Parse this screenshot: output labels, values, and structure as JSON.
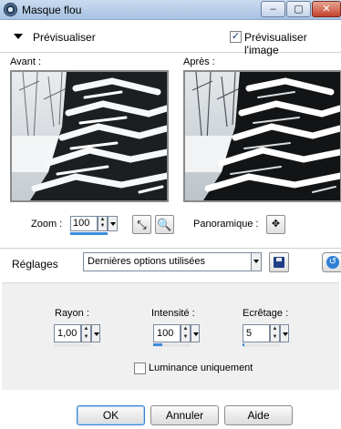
{
  "window": {
    "title": "Masque flou",
    "minimize": "–",
    "maximize": "▢",
    "close": "✕"
  },
  "preview": {
    "section_label": "Prévisualiser",
    "checkbox_label": "Prévisualiser l'image",
    "checkbox_checked": true,
    "checkbox_mark": "✓"
  },
  "before": {
    "label": "Avant :"
  },
  "after": {
    "label": "Après :"
  },
  "zoom": {
    "label": "Zoom :",
    "value": "100",
    "slider_fraction": 1.0,
    "fit_icon": "⤡",
    "actual_icon": "🔍"
  },
  "pan": {
    "label": "Panoramique :",
    "icon": "✥"
  },
  "settings": {
    "label": "Réglages",
    "preset_value": "Dernières options utilisées"
  },
  "params": {
    "radius": {
      "label": "Rayon :",
      "value": "1,00",
      "slider_fraction": 0.0
    },
    "intensity": {
      "label": "Intensité :",
      "value": "100",
      "slider_fraction": 0.25
    },
    "clipping": {
      "label": "Ecrêtage :",
      "value": "5",
      "slider_fraction": 0.05
    }
  },
  "luminance": {
    "label": "Luminance uniquement",
    "checked": false
  },
  "buttons": {
    "ok": "OK",
    "cancel": "Annuler",
    "help": "Aide"
  },
  "colors": {
    "accent": "#3c8ddc",
    "title_bar": "#b7cde8"
  }
}
